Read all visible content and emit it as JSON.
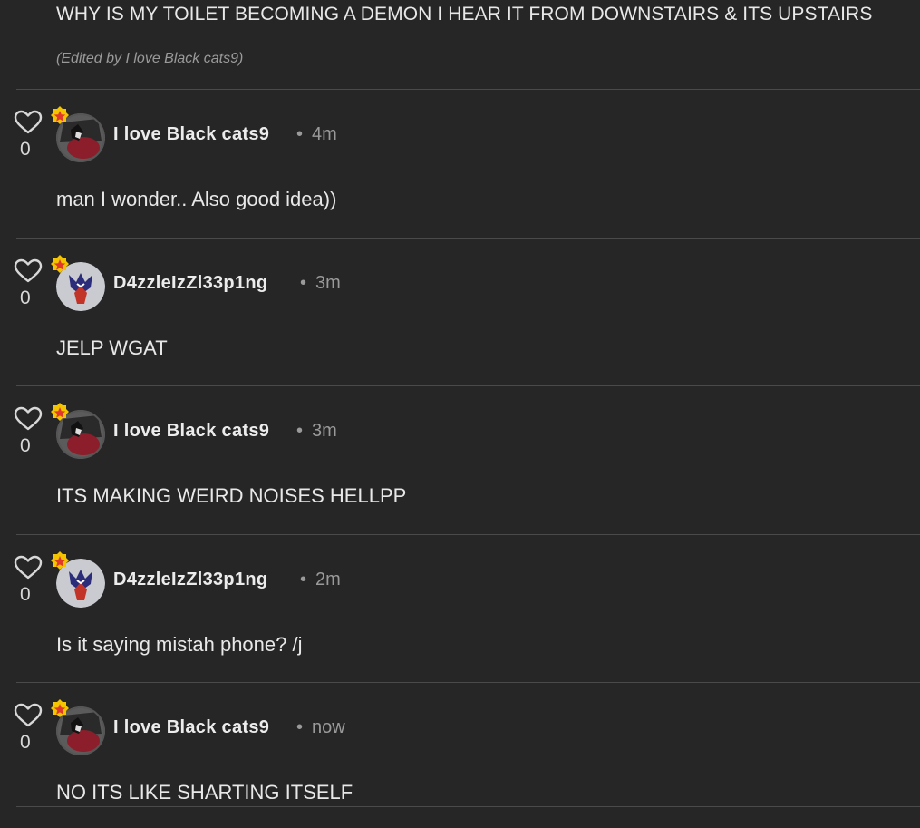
{
  "top": {
    "message": "WHY IS MY TOILET BECOMING A DEMON I HEAR IT FROM DOWNSTAIRS & ITS UPSTAIRS",
    "edited_note": "(Edited by I love Black cats9)"
  },
  "comments": [
    {
      "author": "I love Black cats9",
      "separator": "•",
      "time": "4m",
      "likes": "0",
      "text": "man I wonder.. Also good idea))",
      "avatar": "cat"
    },
    {
      "author": "D4zzleIzZl33p1ng",
      "separator": "•",
      "time": "3m",
      "likes": "0",
      "text": "JELP WGAT",
      "avatar": "wolf"
    },
    {
      "author": "I love Black cats9",
      "separator": "•",
      "time": "3m",
      "likes": "0",
      "text": "ITS MAKING WEIRD NOISES HELLPP",
      "avatar": "cat"
    },
    {
      "author": "D4zzleIzZl33p1ng",
      "separator": "•",
      "time": "2m",
      "likes": "0",
      "text": "Is it saying mistah phone? /j",
      "avatar": "wolf"
    },
    {
      "author": "I love Black cats9",
      "separator": "•",
      "time": "now",
      "likes": "0",
      "text": "NO ITS LIKE SHARTING ITSELF",
      "avatar": "cat"
    }
  ],
  "icons": {
    "like": "heart-outline-icon",
    "badge": "star-badge-icon"
  },
  "colors": {
    "background": "#262626",
    "badge": "#f5c400",
    "badge_star": "#e0392b",
    "muted": "#9a9a9a"
  }
}
